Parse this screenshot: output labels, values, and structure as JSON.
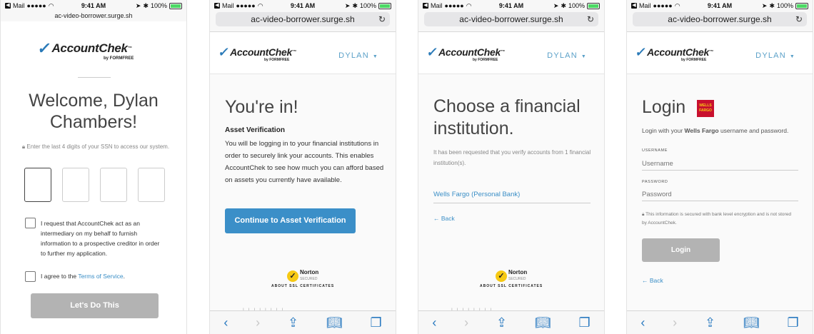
{
  "status": {
    "carrier": "Mail",
    "signal": "●●●●●",
    "time": "9:41 AM",
    "battery": "100%"
  },
  "screen1": {
    "url": "ac-video-borrower.surge.sh",
    "logo": {
      "brand": "AccountChek",
      "tm": "™",
      "by": "by FORMFREE"
    },
    "welcome": "Welcome, Dylan Chambers!",
    "ssn_prompt": "Enter the last 4 digits of your SSN to access our system.",
    "consent1": "I request that AccountChek act as an intermediary on my behalf to furnish information to a prospective creditor in order to further my application.",
    "consent2_prefix": "I agree to the ",
    "consent2_link": "Terms of Service",
    "consent2_suffix": ".",
    "button": "Let's Do This"
  },
  "screen2": {
    "url": "ac-video-borrower.surge.sh",
    "user": "DYLAN",
    "heading": "You're in!",
    "subheading": "Asset Verification",
    "body": "You will be logging in to your financial institutions in order to securely link your accounts. This enables AccountChek to see how much you can afford based on assets you currently have available.",
    "button": "Continue to Asset Verification",
    "norton": {
      "name": "Norton",
      "sub": "SECURED",
      "caption": "ABOUT SSL CERTIFICATES"
    }
  },
  "screen3": {
    "url": "ac-video-borrower.surge.sh",
    "user": "DYLAN",
    "heading": "Choose a financial institution.",
    "note": "It has been requested that you verify accounts from 1 financial institution(s).",
    "institution": "Wells Fargo (Personal Bank)",
    "back": "← Back",
    "norton": {
      "name": "Norton",
      "sub": "SECURED",
      "caption": "ABOUT SSL CERTIFICATES"
    }
  },
  "screen4": {
    "url": "ac-video-borrower.surge.sh",
    "user": "DYLAN",
    "heading": "Login",
    "bank_logo": "WELLS FARGO",
    "intro_prefix": "Login with your ",
    "intro_bank": "Wells Fargo",
    "intro_suffix": " username and password.",
    "username_label": "USERNAME",
    "username_placeholder": "Username",
    "password_label": "PASSWORD",
    "password_placeholder": "Password",
    "security_note": "This information is secured with bank level encryption and is not stored by AccountChek.",
    "button": "Login",
    "back": "← Back"
  },
  "colors": {
    "accent": "#3a8ec6",
    "primary_button": "#3b8fc8",
    "disabled_button": "#b3b3b3",
    "wells_fargo": "#c8102e"
  }
}
